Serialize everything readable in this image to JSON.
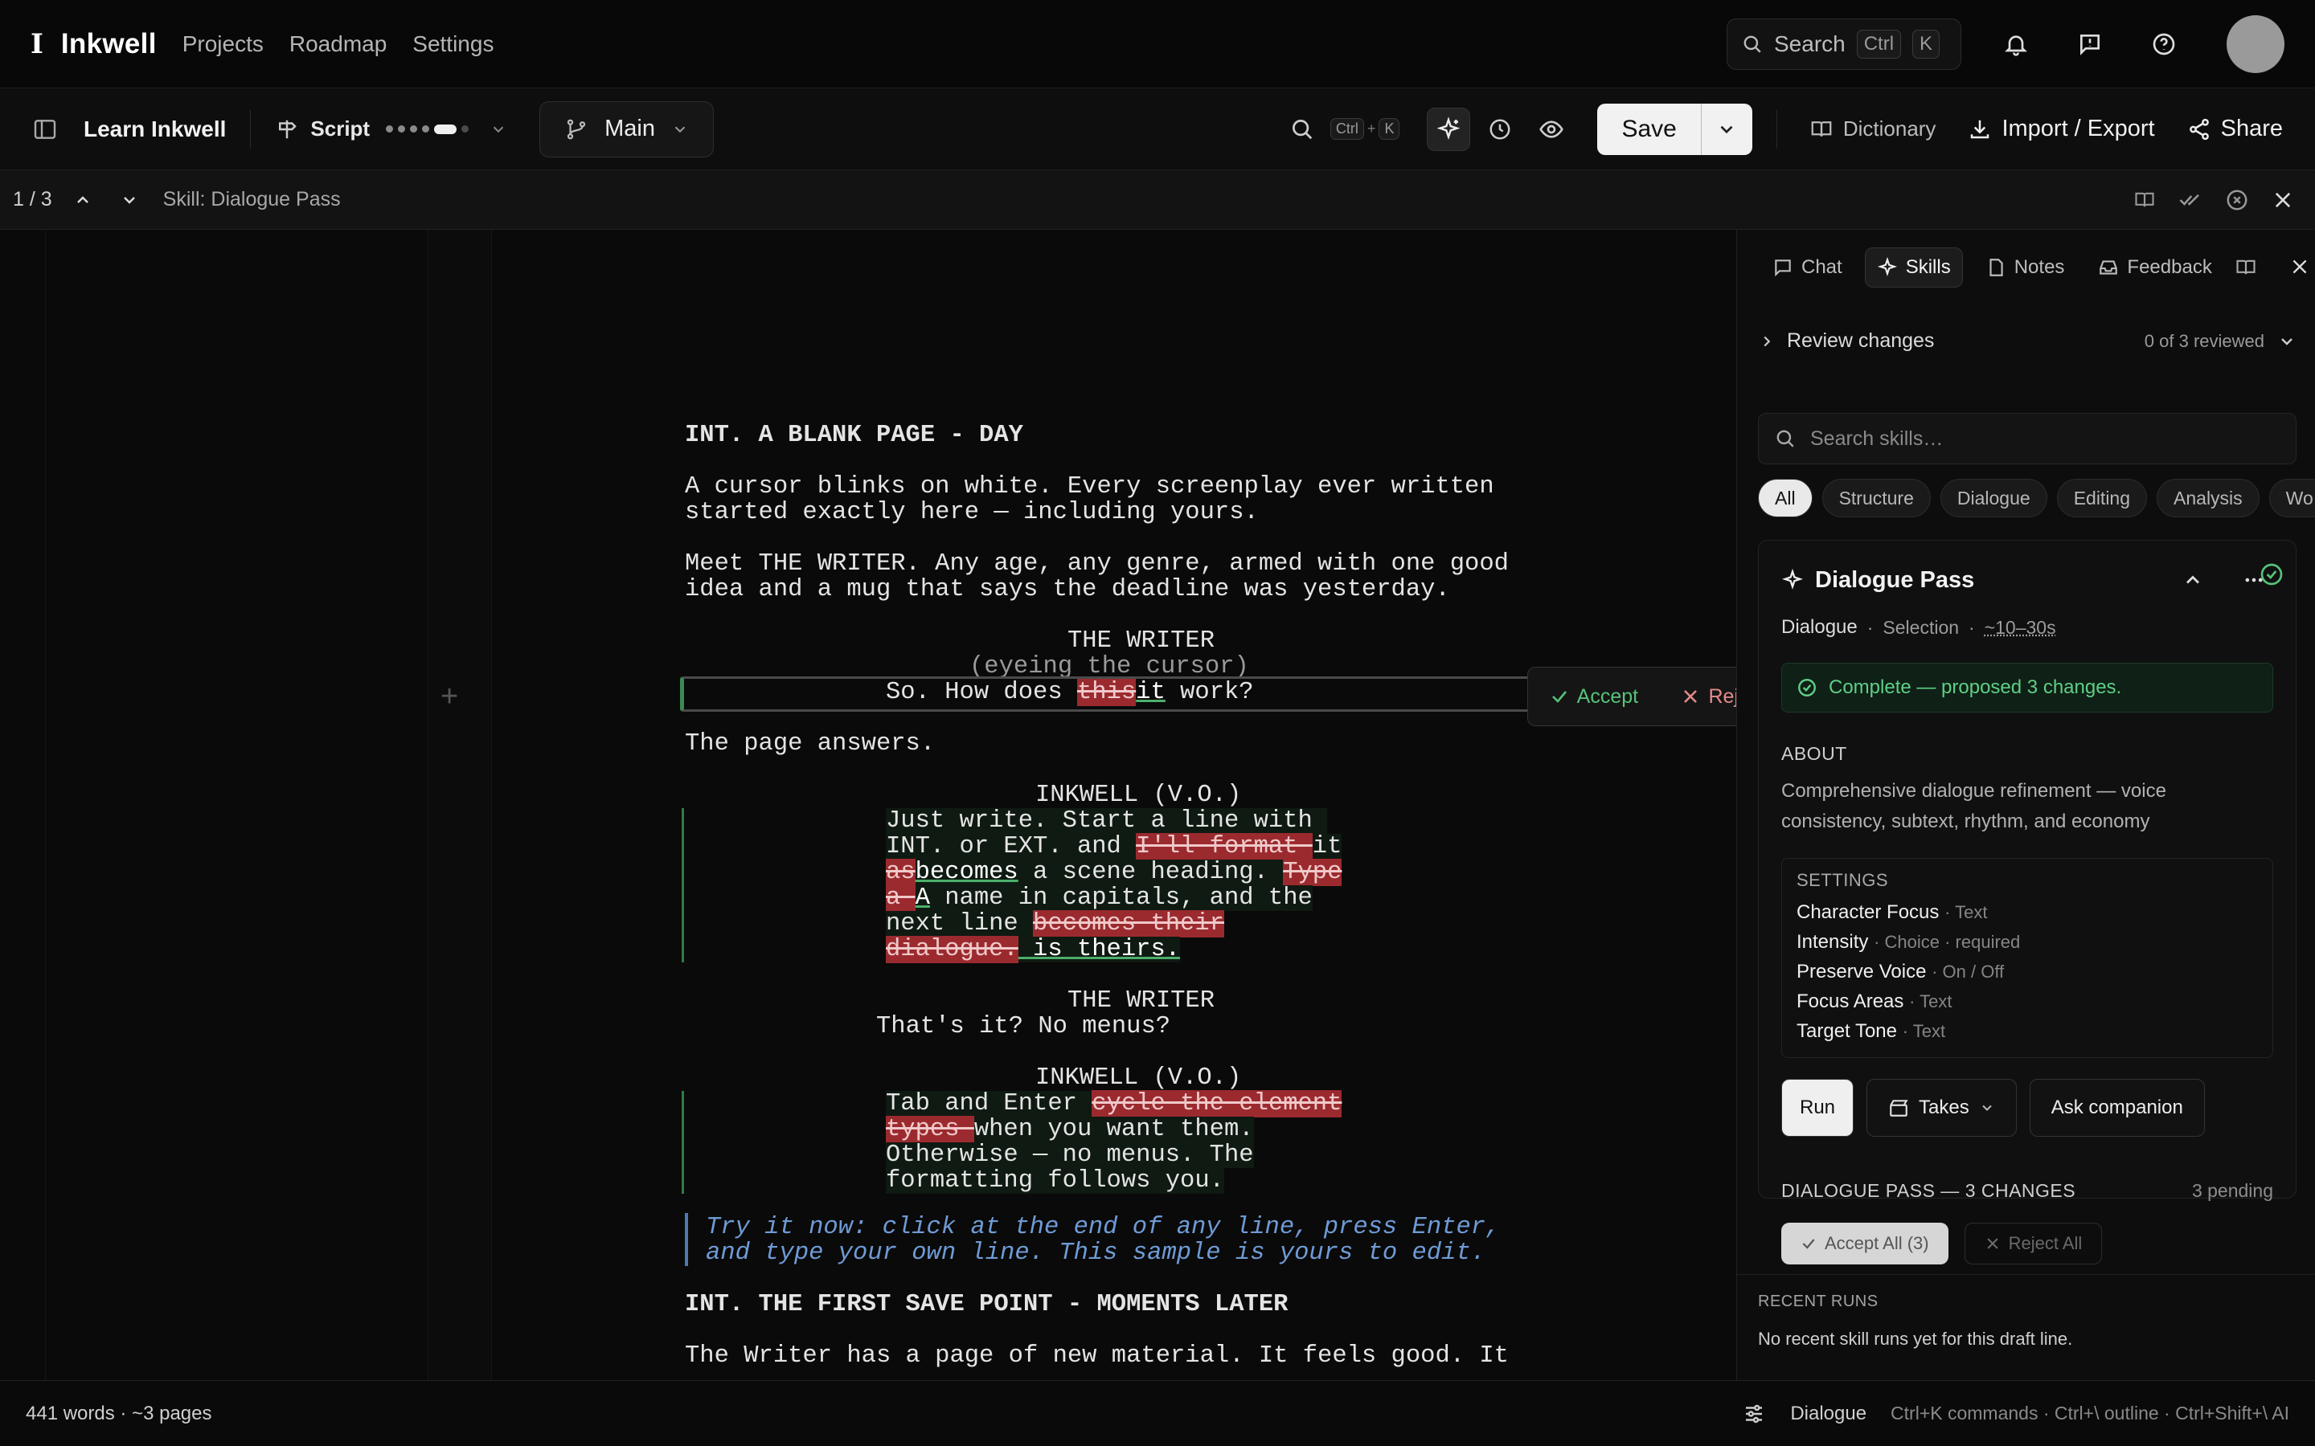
{
  "app": {
    "brand_mark": "I",
    "name": "Inkwell"
  },
  "nav": {
    "items": [
      "Projects",
      "Roadmap",
      "Settings"
    ]
  },
  "search": {
    "label": "Search",
    "kbd1": "Ctrl",
    "kbd2": "K"
  },
  "toolbar": {
    "doc_title": "Learn Inkwell",
    "script_label": "Script",
    "branch": "Main",
    "find_kbd1": "Ctrl",
    "find_plus": "+",
    "find_kbd2": "K",
    "save_label": "Save",
    "dictionary": "Dictionary",
    "import_export": "Import / Export",
    "share": "Share"
  },
  "review_bar": {
    "count": "1 / 3",
    "skill": "Skill: Dialogue Pass"
  },
  "script": {
    "heading1": "INT. A BLANK PAGE - DAY",
    "action1_l1": "A cursor blinks on white. Every screenplay ever written",
    "action1_l2": "started exactly here — including yours.",
    "action2_l1": "Meet THE WRITER. Any age, any genre, armed with one good",
    "action2_l2": "idea and a mug that says the deadline was yesterday.",
    "char1": "THE WRITER",
    "paren1": "(eyeing the cursor)",
    "d1_pre": "So. How does ",
    "d1_del": "this",
    "d1_ins": "it",
    "d1_post": " work?",
    "action3": "The page answers.",
    "char2": "INKWELL (V.O.)",
    "d2_l1": "Just write. Start a line with ",
    "d2_l2_pre": "INT. or EXT. and ",
    "d2_l2_del": "I'll format ",
    "d2_l2_post": "it",
    "d2_l3_del": "as",
    "d2_l3_ins": "becomes",
    "d2_l3_mid": " a scene heading. ",
    "d2_l3_del2": "Type",
    "d2_l4_del": "a ",
    "d2_l4_ins": "A",
    "d2_l4_post": " name in capitals, and the",
    "d2_l5_pre": "next line ",
    "d2_l5_del": "becomes their",
    "d2_l6_del": "dialogue.",
    "d2_l6_ins": " is theirs.",
    "char3": "THE WRITER",
    "d3": "That's it? No menus?",
    "char4": "INKWELL (V.O.)",
    "d4_l1_pre": "Tab and Enter ",
    "d4_l1_del": "cycle the element",
    "d4_l2_del": "types ",
    "d4_l2_post": "when you want them.",
    "d4_l3": "Otherwise — no menus. The",
    "d4_l4": "formatting follows you.",
    "note_l1": "Try it now: click at the end of any line, press Enter,",
    "note_l2": "and type your own line. This sample is yours to edit.",
    "heading2": "INT. THE FIRST SAVE POINT - MOMENTS LATER",
    "action4": "The Writer has a page of new material. It feels good. It"
  },
  "popover": {
    "accept": "Accept",
    "reject": "Reject"
  },
  "panel": {
    "tabs": [
      "Chat",
      "Skills",
      "Notes",
      "Feedback"
    ],
    "review_label": "Review changes",
    "review_count": "0 of 3 reviewed",
    "search_placeholder": "Search skills…",
    "chips": [
      "All",
      "Structure",
      "Dialogue",
      "Editing",
      "Analysis",
      "Wo"
    ],
    "card": {
      "title": "Dialogue Pass",
      "category": "Dialogue",
      "scope": "Selection",
      "duration": "~10–30s",
      "status": "Complete — proposed 3 changes.",
      "about_heading": "ABOUT",
      "about_text": "Comprehensive dialogue refinement — voice consistency, subtext, rhythm, and economy",
      "settings_heading": "SETTINGS",
      "settings": [
        {
          "name": "Character Focus",
          "type": "Text"
        },
        {
          "name": "Intensity",
          "type": "Choice · required"
        },
        {
          "name": "Preserve Voice",
          "type": "On / Off"
        },
        {
          "name": "Focus Areas",
          "type": "Text"
        },
        {
          "name": "Target Tone",
          "type": "Text"
        }
      ],
      "run": "Run",
      "takes": "Takes",
      "ask": "Ask companion",
      "changes_heading": "DIALOGUE PASS — 3 CHANGES",
      "changes_pending": "3 pending",
      "accept_all": "Accept All (3)",
      "reject_all": "Reject All"
    },
    "recent_heading": "RECENT RUNS",
    "recent_text": "No recent skill runs yet for this draft line."
  },
  "status": {
    "words": "441 words · ~3 pages",
    "element": "Dialogue",
    "hints": "Ctrl+K commands · Ctrl+\\ outline · Ctrl+Shift+\\ AI"
  },
  "colors": {
    "accent_green": "#57c27a",
    "delete_red": "#9b2a2f",
    "note_blue": "#6f9bd6"
  }
}
